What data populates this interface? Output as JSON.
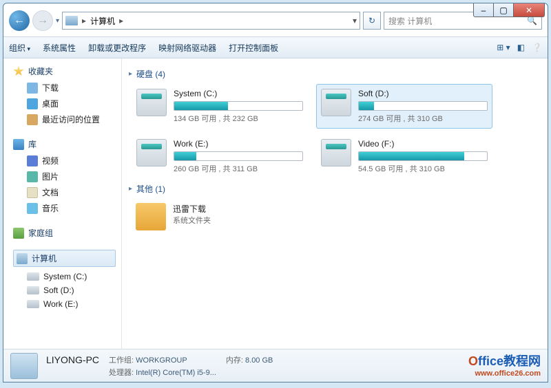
{
  "titlebar": {
    "min": "–",
    "max": "▢",
    "close": "✕"
  },
  "nav": {
    "back": "←",
    "fwd": "→",
    "dropdown": "▾",
    "path": "计算机",
    "path_sep": "▸",
    "refresh": "↻",
    "search_placeholder": "搜索 计算机"
  },
  "toolbar": {
    "organize": "组织",
    "items": [
      "系统属性",
      "卸载或更改程序",
      "映射网络驱动器",
      "打开控制面板"
    ]
  },
  "sidebar": {
    "favorites": {
      "label": "收藏夹",
      "items": [
        "下载",
        "桌面",
        "最近访问的位置"
      ]
    },
    "libraries": {
      "label": "库",
      "items": [
        "视频",
        "图片",
        "文档",
        "音乐"
      ]
    },
    "homegroup": {
      "label": "家庭组"
    },
    "computer": {
      "label": "计算机",
      "items": [
        "System (C:)",
        "Soft (D:)",
        "Work (E:)"
      ]
    }
  },
  "main": {
    "hdd_header": "硬盘 (4)",
    "other_header": "其他 (1)",
    "drives": [
      {
        "name": "System (C:)",
        "free": "134 GB",
        "total": "232 GB",
        "pct": 42,
        "selected": false
      },
      {
        "name": "Soft (D:)",
        "free": "274 GB",
        "total": "310 GB",
        "pct": 12,
        "selected": true
      },
      {
        "name": "Work (E:)",
        "free": "260 GB",
        "total": "311 GB",
        "pct": 17,
        "selected": false
      },
      {
        "name": "Video (F:)",
        "free": "54.5 GB",
        "total": "310 GB",
        "pct": 82,
        "selected": false
      }
    ],
    "stat_tpl_mid": " 可用 , 共 ",
    "folder": {
      "name": "迅雷下载",
      "sub": "系统文件夹"
    }
  },
  "status": {
    "name": "LIYONG-PC",
    "workgroup_label": "工作组:",
    "workgroup": "WORKGROUP",
    "mem_label": "内存:",
    "mem": "8.00 GB",
    "cpu_label": "处理器:",
    "cpu": "Intel(R) Core(TM) i5-9..."
  },
  "watermark": {
    "brand1": "O",
    "brand2": "ffice教程网",
    "url": "www.office26.com"
  }
}
